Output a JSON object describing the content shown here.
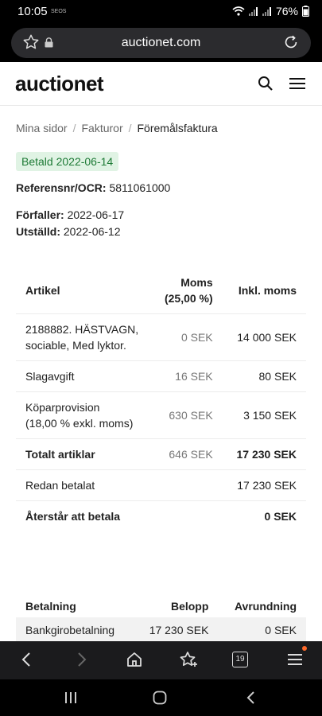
{
  "status": {
    "time": "10:05",
    "carrier_small": "SEOS",
    "battery": "76%"
  },
  "browser": {
    "url": "auctionet.com",
    "tab_count": "19"
  },
  "site": {
    "logo": "auctionet"
  },
  "breadcrumb": {
    "items": [
      "Mina sidor",
      "Fakturor",
      "Föremålsfaktura"
    ]
  },
  "invoice": {
    "status_badge": "Betald 2022-06-14",
    "ref_label": "Referensnr/OCR:",
    "ref_value": "5811061000",
    "due_label": "Förfaller:",
    "due_value": "2022-06-17",
    "issued_label": "Utställd:",
    "issued_value": "2022-06-12"
  },
  "items_table": {
    "headers": {
      "article": "Artikel",
      "vat_line1": "Moms",
      "vat_line2": "(25,00 %)",
      "incl": "Inkl. moms"
    },
    "rows": [
      {
        "article_line1": "2188882. HÄSTVAGN,",
        "article_line2": "sociable, Med lyktor.",
        "vat": "0 SEK",
        "incl": "14 000 SEK"
      },
      {
        "article_line1": "Slagavgift",
        "article_line2": "",
        "vat": "16 SEK",
        "incl": "80 SEK"
      },
      {
        "article_line1": "Köparprovision",
        "article_line2": "(18,00 % exkl. moms)",
        "vat": "630 SEK",
        "incl": "3 150 SEK"
      },
      {
        "article_line1": "Totalt artiklar",
        "article_line2": "",
        "vat": "646 SEK",
        "incl": "17 230 SEK"
      },
      {
        "article_line1": "Redan betalat",
        "article_line2": "",
        "vat": "",
        "incl": "17 230 SEK"
      },
      {
        "article_line1": "Återstår att betala",
        "article_line2": "",
        "vat": "",
        "incl": "0 SEK"
      }
    ]
  },
  "payments_table": {
    "headers": {
      "payment": "Betalning",
      "amount": "Belopp",
      "rounding": "Avrundning"
    },
    "rows": [
      {
        "payment": "Bankgirobetalning",
        "amount": "17 230 SEK",
        "rounding": "0 SEK"
      }
    ]
  }
}
